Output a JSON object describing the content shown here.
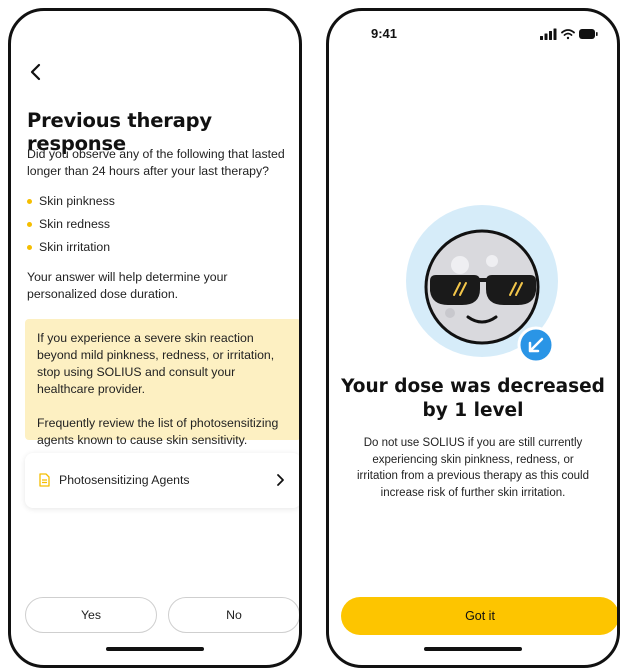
{
  "therapy": {
    "title": "Previous therapy response",
    "intro": "Did you observe any of the following that lasted longer than 24 hours after your last therapy?",
    "symptoms": [
      "Skin pinkness",
      "Skin redness",
      "Skin irritation"
    ],
    "note": "Your answer will help determine your personalized dose duration.",
    "warning": {
      "paragraph1": "If you experience a severe skin reaction beyond mild pinkness, redness, or irritation, stop using SOLIUS and consult your healthcare provider.",
      "paragraph2": "Frequently review the list of photosensitizing agents known to cause skin sensitivity."
    },
    "agents_link": {
      "label": "Photosensitizing Agents",
      "icon": "document-icon",
      "chevron": "chevron-right-icon"
    },
    "buttons": {
      "yes": "Yes",
      "no": "No"
    }
  },
  "result": {
    "status_time": "9:41",
    "title": "Your dose was decreased by 1 level",
    "description": "Do not use SOLIUS if you are still currently experiencing skin pinkness, redness, or irritation from a previous therapy as this could increase risk of further skin irritation.",
    "button": "Got it",
    "badge_icon": "arrow-down-left-icon"
  },
  "colors": {
    "accent": "#FDC500",
    "warning_bg": "#FDF0C2",
    "bullet": "#F5BE00",
    "badge": "#2A95E6",
    "illustration_bg": "#D6ECF9"
  }
}
